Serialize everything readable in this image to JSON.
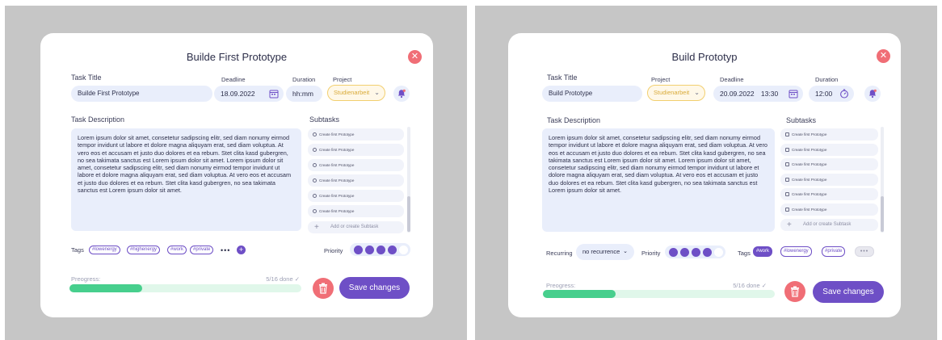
{
  "colors": {
    "accent": "#6e4fc6",
    "danger": "#f06e76",
    "progress": "#47cf8d",
    "project": "#d9ab3a",
    "field": "#e9eefb"
  },
  "left": {
    "title": "Builde First Prototype",
    "close_icon": "close-icon",
    "labels": {
      "task_title": "Task Title",
      "deadline": "Deadline",
      "duration": "Duration",
      "project": "Project",
      "task_description": "Task Description",
      "subtasks": "Subtasks",
      "tags": "Tags",
      "priority": "Priority",
      "progress": "Preogress:"
    },
    "task_title_value": "Builde First Prototype",
    "deadline_value": "18.09.2022",
    "duration_value": "hh:mm",
    "project_value": "Studienarbeit",
    "description": "Lorem ipsum dolor sit amet, consetetur sadipscing elitr, sed diam nonumy eirmod tempor invidunt ut labore et dolore magna aliquyam erat, sed diam voluptua. At vero eos et accusam et justo duo dolores et ea rebum. Stet clita kasd gubergren, no sea takimata sanctus est Lorem ipsum dolor sit amet. Lorem ipsum dolor sit amet, consetetur sadipscing elitr, sed diam nonumy eirmod tempor invidunt ut labore et dolore magna aliquyam erat, sed diam voluptua. At vero eos et accusam et justo duo dolores et ea rebum. Stet clita kasd gubergren, no sea takimata sanctus est Lorem ipsum dolor sit amet.",
    "subtasks": [
      "Create first Prototype",
      "Create first Prototype",
      "Create first Prototype",
      "Create first Prototype",
      "Create first Prototype",
      "Create first Prototype"
    ],
    "add_subtask": "Add or create Subtask",
    "tags": [
      "#lowenergy",
      "#highenergy",
      "#work",
      "#private"
    ],
    "more_tags": "•••",
    "add_tag": "+",
    "priority_level": 4,
    "priority_max": 5,
    "progress_text": "5/16 done ✓",
    "progress_fraction": 0.3125,
    "save_label": "Save changes"
  },
  "right": {
    "title": "Build Prototyp",
    "labels": {
      "task_title": "Task Title",
      "project": "Project",
      "deadline": "Deadline",
      "duration": "Duration",
      "task_description": "Task Description",
      "subtasks": "Subtasks",
      "recurring": "Recurring",
      "priority": "Priority",
      "tags": "Tags",
      "progress": "Preogress:"
    },
    "task_title_value": "Build Prototype",
    "project_value": "Studienarbeit",
    "deadline_date": "20.09.2022",
    "deadline_time": "13:30",
    "duration_value": "12:00",
    "description": "Lorem ipsum dolor sit amet, consetetur sadipscing elitr, sed diam nonumy eirmod tempor invidunt ut labore et dolore magna aliquyam erat, sed diam voluptua. At vero eos et accusam et justo duo dolores et ea rebum. Stet clita kasd gubergren, no sea takimata sanctus est Lorem ipsum dolor sit amet. Lorem ipsum dolor sit amet, consetetur sadipscing elitr, sed diam nonumy eirmod tempor invidunt ut labore et dolore magna aliquyam erat, sed diam voluptua. At vero eos et accusam et justo duo dolores et ea rebum. Stet clita kasd gubergren, no sea takimata sanctus est Lorem ipsum dolor sit amet.",
    "subtasks": [
      "Create first Prototype",
      "Create first Prototype",
      "Create first Prototype",
      "Create first Prototype",
      "Create first Prototype",
      "Create first Prototype"
    ],
    "add_subtask": "Add or create Subtask",
    "recurring_value": "no recurrence",
    "priority_level": 4,
    "priority_max": 5,
    "tags": [
      "#work",
      "#lowenergy",
      "#private"
    ],
    "more_tags": "•••",
    "progress_text": "5/16 done ✓",
    "progress_fraction": 0.3125,
    "save_label": "Save changes"
  }
}
